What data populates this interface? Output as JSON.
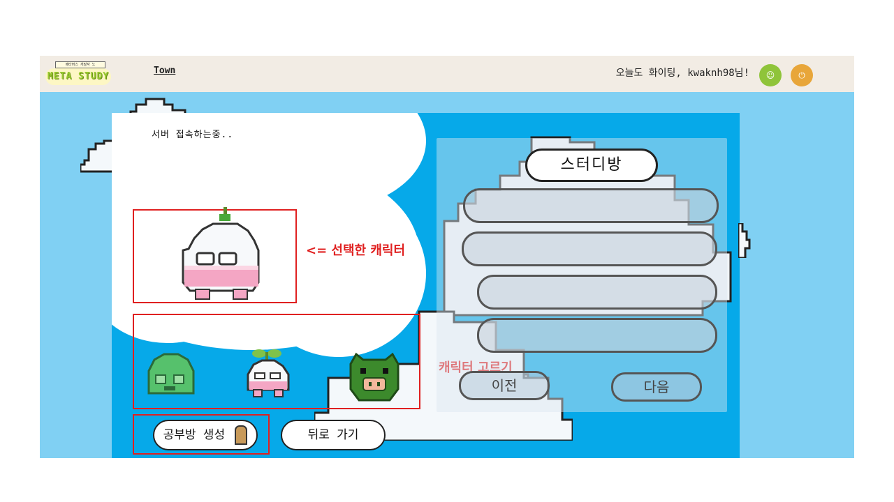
{
  "header": {
    "logo_top": "메타버스 개발자 노",
    "logo_text": "META STUDY",
    "nav_town": "Town",
    "greeting": "오늘도 화이팅, kwaknh98님!",
    "user_icon": "user-icon",
    "power_icon": "power-icon",
    "user_glyph": "☺",
    "power_glyph": "⏻"
  },
  "main": {
    "status": "서버 접속하는중..",
    "selected_label": "<= 선택한 캐릭터",
    "choose_label": "캐릭터 고르기",
    "create_button": "공부방 생성",
    "back_button": "뒤로 가기"
  },
  "panel": {
    "title": "스터디방",
    "prev_button": "이전",
    "next_button": "다음"
  },
  "characters": [
    {
      "name": "green-slime-character",
      "color": "#56c16c"
    },
    {
      "name": "white-sprout-character",
      "color": "#f5f7fa"
    },
    {
      "name": "green-pig-character",
      "color": "#3c8a2c"
    }
  ],
  "colors": {
    "header_bg": "#f2ece4",
    "sky": "#80d0f3",
    "main_bg": "#06a9e9",
    "accent_red": "#e02020",
    "user_button": "#8fc43a",
    "power_button": "#e8a63a"
  }
}
